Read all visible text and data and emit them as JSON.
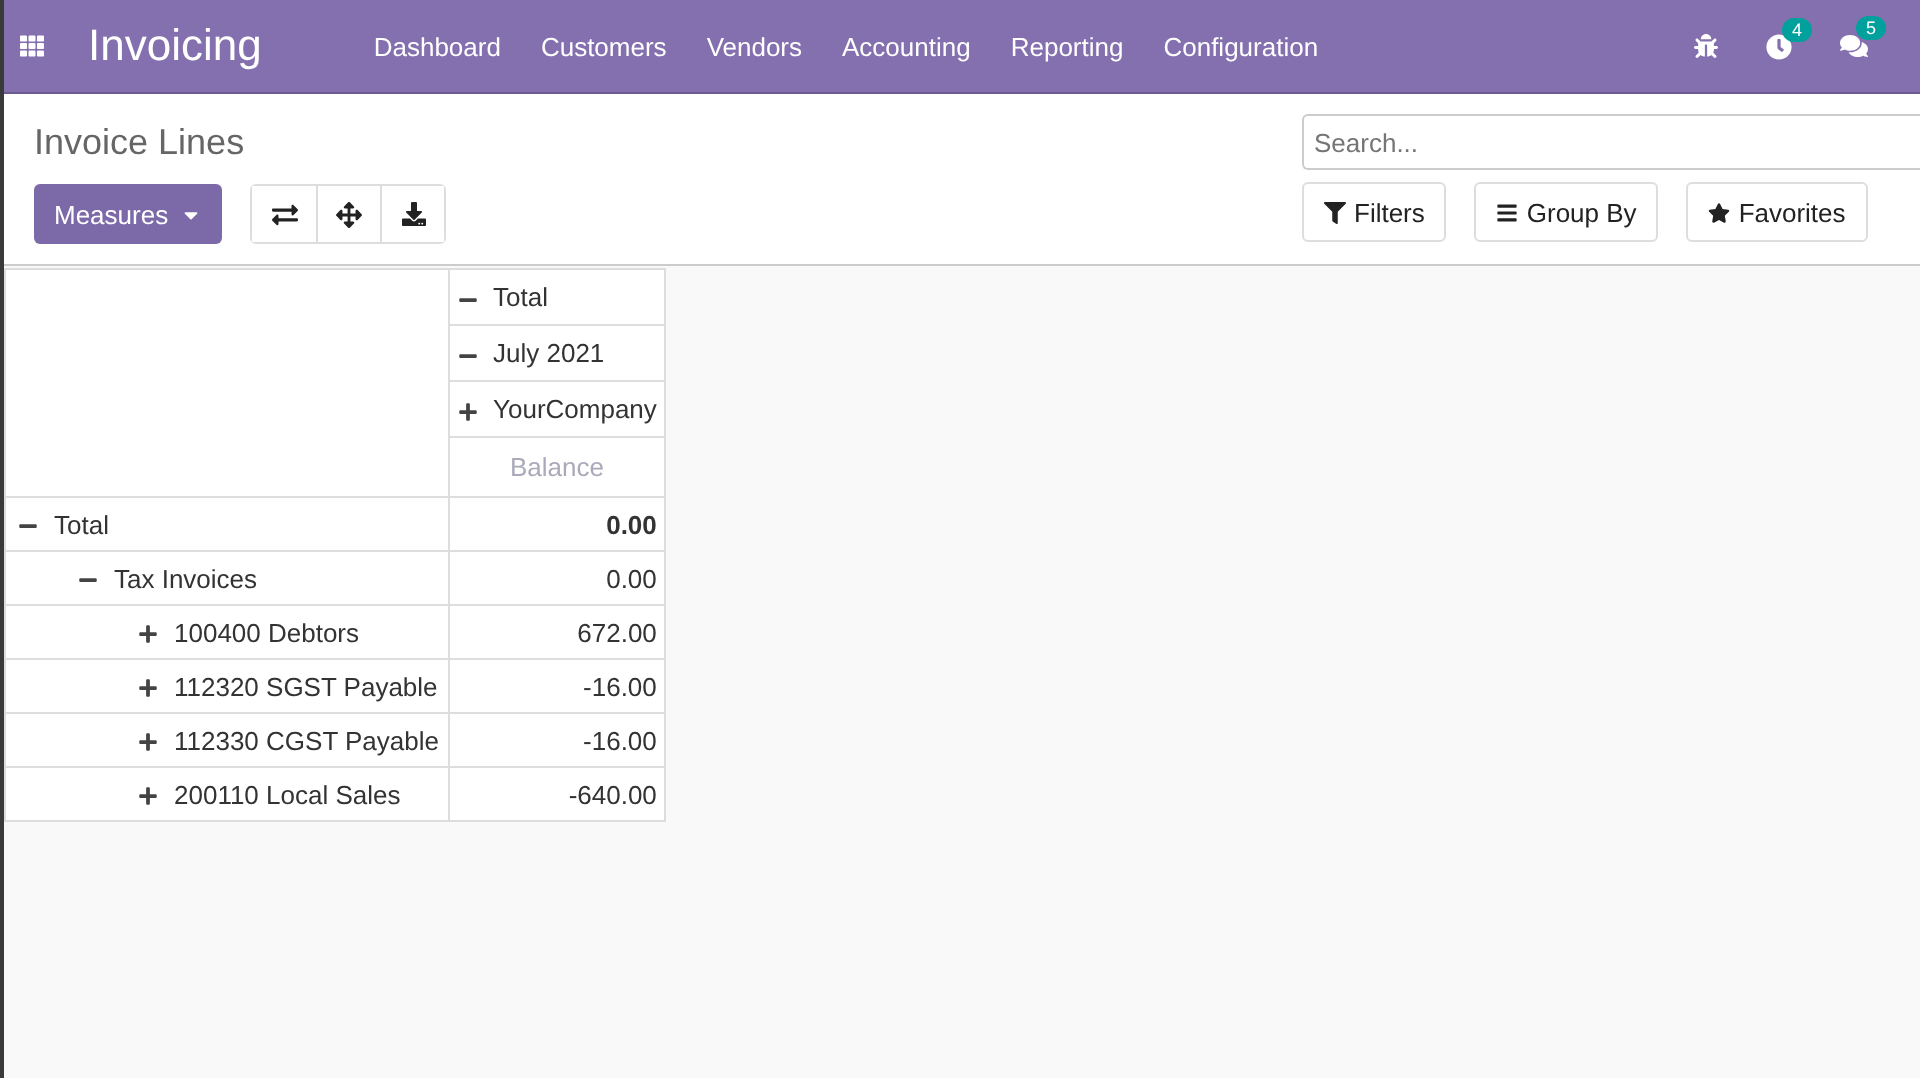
{
  "navbar": {
    "app_name": "Invoicing",
    "menu": [
      "Dashboard",
      "Customers",
      "Vendors",
      "Accounting",
      "Reporting",
      "Configuration"
    ],
    "activity_count": "4",
    "message_count": "5"
  },
  "control_panel": {
    "title": "Invoice Lines",
    "measures_label": "Measures",
    "search": {
      "placeholder": "Search..."
    },
    "filters": [
      "Filters",
      "Group By",
      "Favorites"
    ]
  },
  "pivot": {
    "column_headers": [
      {
        "label": "Total",
        "expanded": true
      },
      {
        "label": "July 2021",
        "expanded": true
      },
      {
        "label": "YourCompany",
        "expanded": false
      }
    ],
    "measure": "Balance",
    "rows": [
      {
        "label": "Total",
        "value": "0.00",
        "expanded": true,
        "children": [
          {
            "label": "Tax Invoices",
            "value": "0.00",
            "expanded": true,
            "children": [
              {
                "label": "100400 Debtors",
                "value": "672.00",
                "expanded": false
              },
              {
                "label": "112320 SGST Payable",
                "value": "-16.00",
                "expanded": false
              },
              {
                "label": "112330 CGST Payable",
                "value": "-16.00",
                "expanded": false
              },
              {
                "label": "200110 Local Sales",
                "value": "-640.00",
                "expanded": false
              }
            ]
          }
        ]
      }
    ]
  }
}
